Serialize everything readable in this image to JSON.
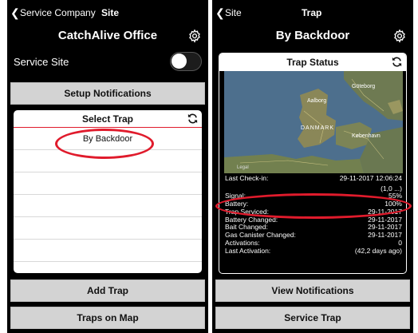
{
  "left": {
    "nav": {
      "back_label": "Service Company",
      "current": "Site"
    },
    "title": "CatchAlive Office",
    "service_site_label": "Service Site",
    "setup_notifications": "Setup Notifications",
    "select_trap_header": "Select Trap",
    "traps": [
      "By Backdoor",
      "",
      "",
      "",
      "",
      "",
      ""
    ],
    "add_trap": "Add Trap",
    "traps_on_map": "Traps on Map"
  },
  "right": {
    "nav": {
      "back_label": "Site",
      "current": "Trap"
    },
    "title": "By Backdoor",
    "status_header": "Trap Status",
    "map_labels": {
      "city1": "Göteborg",
      "city2": "Aalborg",
      "country": "DANMARK",
      "city3": "København",
      "legal": "Legal"
    },
    "status": [
      {
        "label": "Last Check-in:",
        "value": "29-11-2017 12:06:24"
      },
      {
        "label": "",
        "value": "(1,0 ...)"
      },
      {
        "label": "Signal:",
        "value": "55%"
      },
      {
        "label": "Battery:",
        "value": "100%"
      },
      {
        "label": "Trap Serviced:",
        "value": "29-11-2017"
      },
      {
        "label": "Battery Changed:",
        "value": "29-11-2017"
      },
      {
        "label": "Bait Changed:",
        "value": "29-11-2017"
      },
      {
        "label": "Gas Canister Changed:",
        "value": "29-11-2017"
      },
      {
        "label": "Activations:",
        "value": "0"
      },
      {
        "label": "Last Activation:",
        "value": "(42,2 days ago)"
      }
    ],
    "view_notifications": "View Notifications",
    "service_trap": "Service Trap"
  },
  "colors": {
    "highlight": "#e01b2c",
    "button": "#d3d3d3",
    "background": "#000000"
  },
  "icons": [
    "chevron-left-icon",
    "gear-icon",
    "refresh-icon",
    "toggle-switch"
  ]
}
